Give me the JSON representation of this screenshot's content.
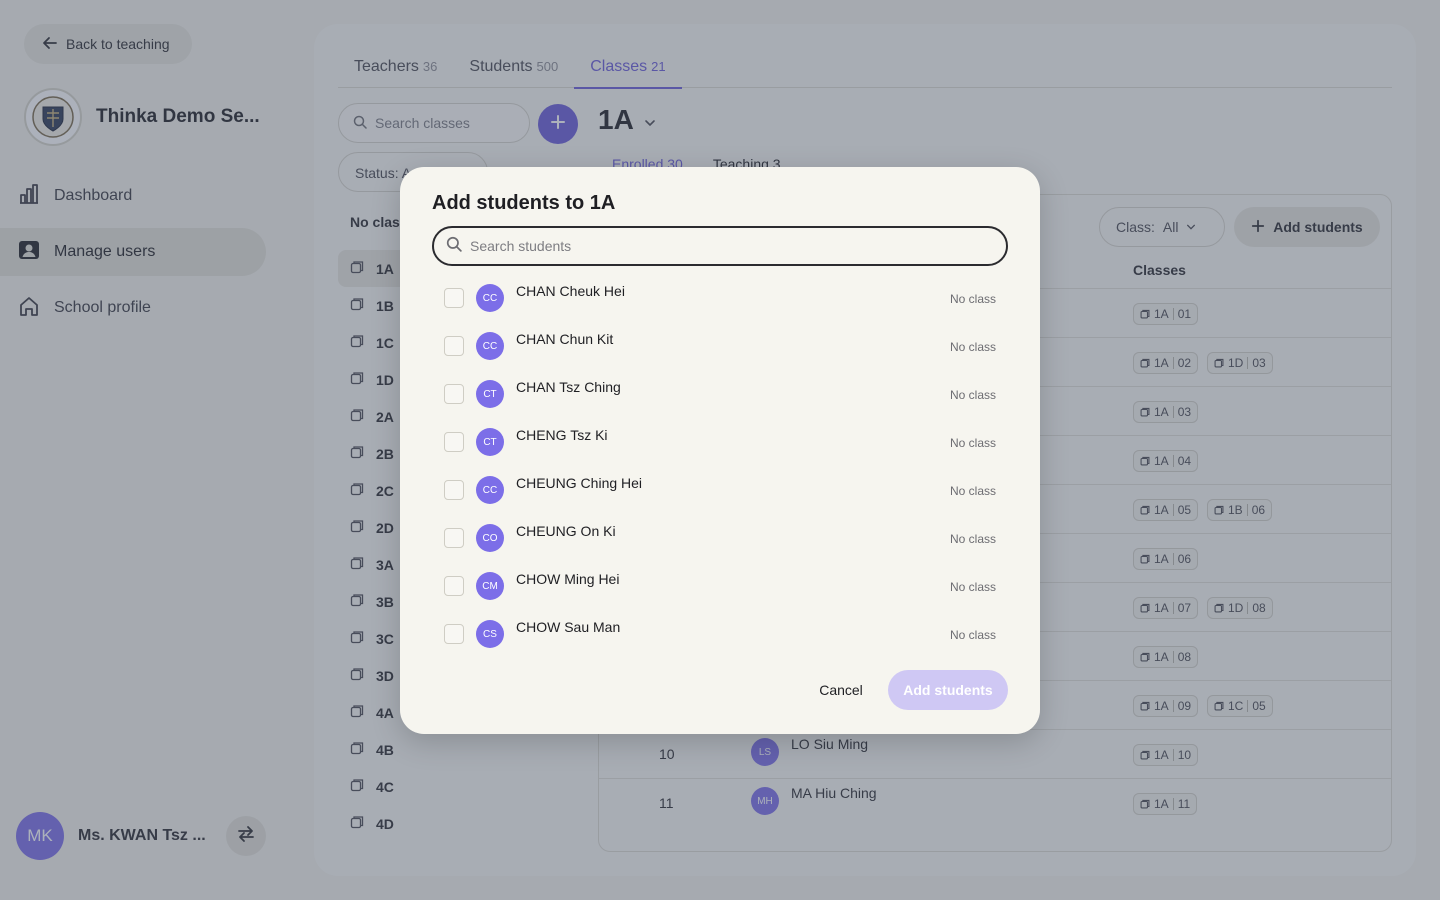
{
  "sidebar": {
    "back_label": "Back to teaching",
    "school_name": "Thinka Demo Se...",
    "nav": [
      {
        "label": "Dashboard",
        "icon": "bar-chart-icon"
      },
      {
        "label": "Manage users",
        "icon": "user-card-icon",
        "active": true
      },
      {
        "label": "School profile",
        "icon": "home-icon"
      }
    ],
    "user": {
      "initials": "MK",
      "name": "Ms. KWAN Tsz ..."
    }
  },
  "main": {
    "tabs": [
      {
        "label": "Teachers",
        "count": "36"
      },
      {
        "label": "Students",
        "count": "500"
      },
      {
        "label": "Classes",
        "count": "21",
        "active": true
      }
    ],
    "search_placeholder": "Search classes",
    "selected_class": "1A",
    "status_filter": "Status: A",
    "subtabs": [
      {
        "label": "Enrolled",
        "count": "30"
      },
      {
        "label": "Teaching",
        "count": "3"
      }
    ],
    "no_class_heading": "No clas",
    "classes": [
      "1A",
      "1B",
      "1C",
      "1D",
      "2A",
      "2B",
      "2C",
      "2D",
      "3A",
      "3B",
      "3C",
      "3D",
      "4A",
      "4B",
      "4C",
      "4D"
    ],
    "class_filter": "Class:",
    "class_filter_value": "All",
    "add_students_label": "Add students",
    "classes_column_header": "Classes",
    "rows": [
      {
        "chips": [
          [
            "1A",
            "01"
          ]
        ]
      },
      {
        "chips": [
          [
            "1A",
            "02"
          ],
          [
            "1D",
            "03"
          ]
        ]
      },
      {
        "chips": [
          [
            "1A",
            "03"
          ]
        ]
      },
      {
        "chips": [
          [
            "1A",
            "04"
          ]
        ]
      },
      {
        "chips": [
          [
            "1A",
            "05"
          ],
          [
            "1B",
            "06"
          ]
        ]
      },
      {
        "chips": [
          [
            "1A",
            "06"
          ]
        ]
      },
      {
        "chips": [
          [
            "1A",
            "07"
          ],
          [
            "1D",
            "08"
          ]
        ]
      },
      {
        "chips": [
          [
            "1A",
            "08"
          ]
        ]
      },
      {
        "chips": [
          [
            "1A",
            "09"
          ],
          [
            "1C",
            "05"
          ]
        ]
      },
      {
        "chips": [
          [
            "1A",
            "10"
          ]
        ],
        "num": "10",
        "initials": "LS",
        "name": "LO Siu Ming",
        "left": "26"
      },
      {
        "chips": [
          [
            "1A",
            "11"
          ]
        ],
        "num": "11",
        "initials": "MH",
        "name": "MA Hiu Ching",
        "left": "23"
      }
    ]
  },
  "modal": {
    "title": "Add students to 1A",
    "search_placeholder": "Search students",
    "students": [
      {
        "initials": "CC",
        "name": "CHAN Cheuk Hei",
        "class": "No class"
      },
      {
        "initials": "CC",
        "name": "CHAN Chun Kit",
        "class": "No class"
      },
      {
        "initials": "CT",
        "name": "CHAN Tsz Ching",
        "class": "No class"
      },
      {
        "initials": "CT",
        "name": "CHENG Tsz Ki",
        "class": "No class"
      },
      {
        "initials": "CC",
        "name": "CHEUNG Ching Hei",
        "class": "No class"
      },
      {
        "initials": "CO",
        "name": "CHEUNG On Ki",
        "class": "No class"
      },
      {
        "initials": "CM",
        "name": "CHOW Ming Hei",
        "class": "No class"
      },
      {
        "initials": "CS",
        "name": "CHOW Sau Man",
        "class": "No class"
      }
    ],
    "cancel_label": "Cancel",
    "add_label": "Add students"
  },
  "colors": {
    "accent": "#6a5cd8",
    "avatar": "#7c6ee8",
    "add_disabled": "#cfc8f4"
  }
}
